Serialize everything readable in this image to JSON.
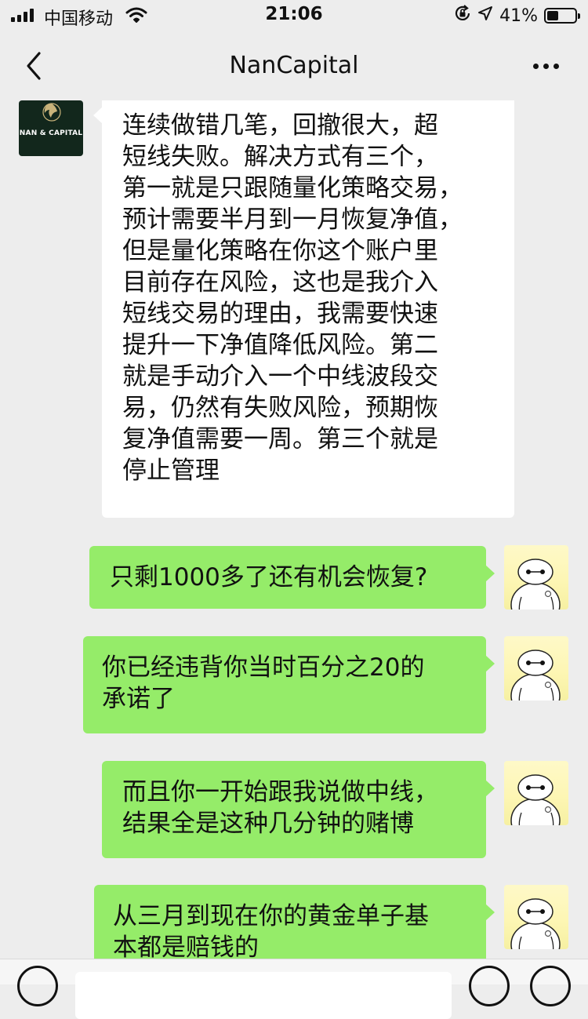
{
  "status_bar": {
    "carrier": "中国移动",
    "time": "21:06",
    "battery": "41%",
    "battery_level": 0.41
  },
  "nav": {
    "title": "NanCapital"
  },
  "company_avatar": {
    "logo_text": "NAN & CAPITAL"
  },
  "messages": [
    {
      "from": "NanCapital",
      "lines": [
        "连续做错几笔，回撤很大，超",
        "短线失败。解决方式有三个，",
        "第一就是只跟随量化策略交易，",
        "预计需要半月到一月恢复净值，",
        "但是量化策略在你这个账户里",
        "目前存在风险，这也是我介入",
        "短线交易的理由，我需要快速",
        "提升一下净值降低风险。第二",
        "就是手动介入一个中线波段交",
        "易，仍然有失败风险，预期恢",
        "复净值需要一周。第三个就是",
        "停止管理"
      ]
    },
    {
      "from": "me",
      "lines": [
        "只剩1000多了还有机会恢复?"
      ]
    },
    {
      "from": "me",
      "lines": [
        "你已经违背你当时百分之20的",
        "承诺了"
      ]
    },
    {
      "from": "me",
      "lines": [
        "而且你一开始跟我说做中线，",
        "结果全是这种几分钟的赌博"
      ]
    },
    {
      "from": "me",
      "lines": [
        "从三月到现在你的黄金单子基",
        "本都是赔钱的"
      ]
    }
  ],
  "colors": {
    "background": "#ededed",
    "outgoing_bubble": "#95ec69",
    "incoming_bubble": "#ffffff"
  },
  "icons": {
    "back": "chevron-left-icon",
    "more": "more-dots-icon",
    "wifi": "wifi-icon",
    "location": "location-arrow-icon",
    "rotation_lock": "rotation-lock-icon"
  }
}
